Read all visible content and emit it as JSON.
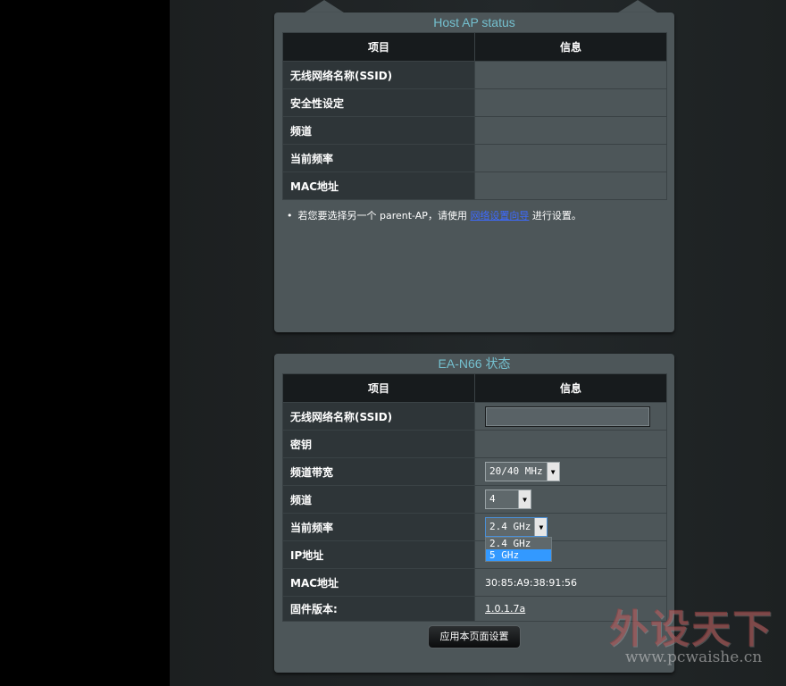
{
  "host_ap_panel": {
    "title": "Host AP status",
    "headers": [
      "项目",
      "信息"
    ],
    "rows": [
      {
        "label": "无线网络名称(SSID)",
        "value": ""
      },
      {
        "label": "安全性设定",
        "value": ""
      },
      {
        "label": "频道",
        "value": ""
      },
      {
        "label": "当前频率",
        "value": ""
      },
      {
        "label": "MAC地址",
        "value": ""
      }
    ],
    "note_before": "若您要选择另一个 parent-AP，请使用 ",
    "note_link": "网络设置向导",
    "note_after": " 进行设置。"
  },
  "ea_panel": {
    "title": "EA-N66 状态",
    "headers": [
      "项目",
      "信息"
    ],
    "rows": {
      "ssid": {
        "label": "无线网络名称(SSID)",
        "value": ""
      },
      "key": {
        "label": "密钥",
        "value": ""
      },
      "bandwidth": {
        "label": "频道带宽",
        "value": "20/40 MHz"
      },
      "channel": {
        "label": "频道",
        "value": "4"
      },
      "frequency": {
        "label": "当前频率",
        "value": "2.4 GHz"
      },
      "ip": {
        "label": "IP地址",
        "value": ""
      },
      "mac": {
        "label": "MAC地址",
        "value": "30:85:A9:38:91:56"
      },
      "firmware": {
        "label": "固件版本:",
        "value": "1.0.1.7a"
      }
    },
    "frequency_options": [
      "2.4 GHz",
      "5 GHz"
    ],
    "highlighted_option": "5 GHz",
    "apply_label": "应用本页面设置"
  },
  "watermark": {
    "text": "外设天下",
    "url": "www.pcwaishe.cn"
  },
  "colors": {
    "title_accent": "#74c0cf",
    "panel_bg": "#4d5659",
    "label_cell_bg": "#2e3538",
    "header_bg": "#171b1d",
    "link": "#3d6aff",
    "selected_option": "#3399ff"
  }
}
